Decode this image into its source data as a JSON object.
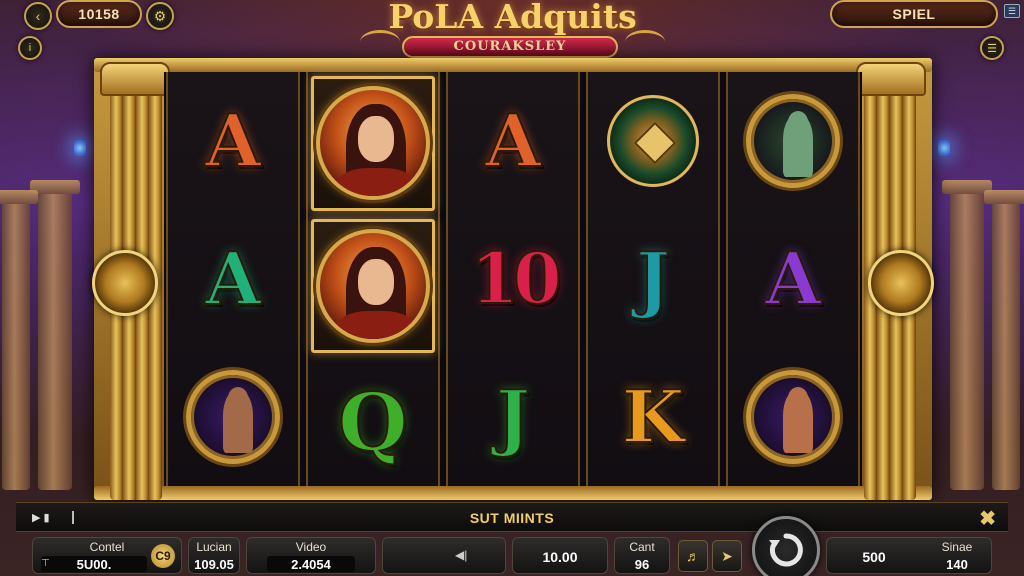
{
  "game": {
    "title": "PoLA Adquits",
    "subtitle": "COURAKSLEY"
  },
  "hud": {
    "balance_display": "10158",
    "spin_label": "SPIEL"
  },
  "reels": [
    [
      {
        "kind": "letter",
        "text": "A",
        "color": "#e0622a"
      },
      {
        "kind": "letter",
        "text": "A",
        "color": "#22b07a"
      },
      {
        "kind": "coin",
        "name": "warrior-coin",
        "bg": "#3a1a6a",
        "fig": "#a36a4a"
      }
    ],
    [
      {
        "kind": "portrait",
        "name": "heroine-portrait"
      },
      {
        "kind": "portrait",
        "name": "heroine-portrait"
      },
      {
        "kind": "letter",
        "text": "Q",
        "color": "#3fae2a"
      }
    ],
    [
      {
        "kind": "letter",
        "text": "A",
        "color": "#e0622a"
      },
      {
        "kind": "letter",
        "text": "10",
        "color": "#d8204a"
      },
      {
        "kind": "letter",
        "text": "J",
        "color": "#2fb04a"
      }
    ],
    [
      {
        "kind": "emblem",
        "name": "shield-emblem"
      },
      {
        "kind": "letter",
        "text": "J",
        "color": "#1e9aa6"
      },
      {
        "kind": "letter",
        "text": "K",
        "color": "#e79a1e"
      }
    ],
    [
      {
        "kind": "coin",
        "name": "goblin-coin",
        "bg": "#2a4a2a",
        "fig": "#6fa07a"
      },
      {
        "kind": "letter",
        "text": "A",
        "color": "#8a3ad0"
      },
      {
        "kind": "coin",
        "name": "warrior-coin",
        "bg": "#3a1a6a",
        "fig": "#b8704a"
      }
    ]
  ],
  "ticker": {
    "message": "SUT MIINTS"
  },
  "bottom": {
    "control_label": "Contel",
    "control_value": "5U00.",
    "control_badge": "C9",
    "lucian_label": "Lucian",
    "lucian_value": "109.05",
    "video_label": "Video",
    "video_value": "2.4054",
    "mid_value": "10.00",
    "cant_label": "Cant",
    "cant_value": "96",
    "bet_value": "500",
    "sinae_label": "Sinae",
    "sinae_value": "140"
  }
}
